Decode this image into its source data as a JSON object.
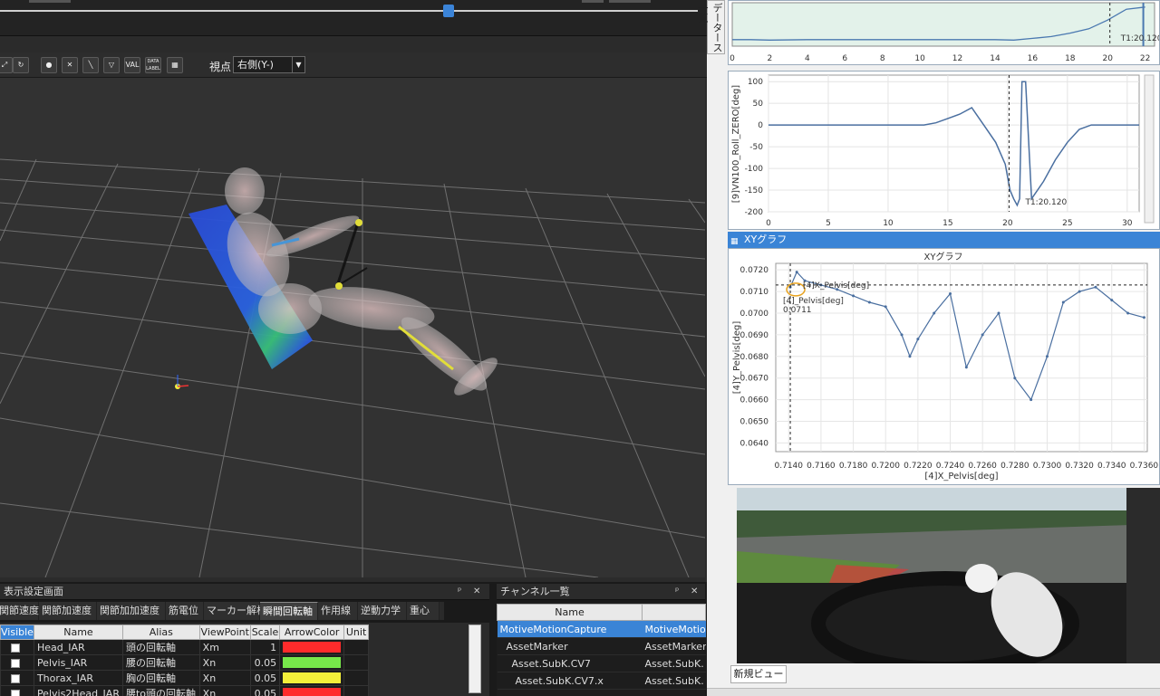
{
  "toolbar": {
    "viewpoint_label": "視点",
    "viewpoint_value": "右側(Y-)",
    "icons": [
      "fit-icon",
      "refresh-icon",
      "person-icon",
      "joint-icon",
      "bone-icon",
      "mesh-icon",
      "val-label-icon",
      "data-label-icon",
      "table-icon"
    ],
    "val_text": "VAL",
    "data_text": "DATA LABEL"
  },
  "settings_panel": {
    "title": "表示設定画面",
    "pin": "ᵖ",
    "close": "✕",
    "tabs": [
      "関節速度",
      "関節加速度",
      "関節加加速度",
      "筋電位",
      "マーカー解析",
      "瞬間回転軸",
      "作用線",
      "逆動力学",
      "重心"
    ],
    "active_tab": "瞬間回転軸",
    "columns": [
      "Visible",
      "Name",
      "Alias",
      "ViewPoint",
      "Scale",
      "ArrowColor",
      "Unit"
    ],
    "rows": [
      {
        "name": "Head_IAR",
        "alias": "頭の回転軸",
        "viewpoint": "Xm",
        "scale": "1",
        "color": "#ff2b2b"
      },
      {
        "name": "Pelvis_IAR",
        "alias": "腰の回転軸",
        "viewpoint": "Xn",
        "scale": "0.05",
        "color": "#77e84a"
      },
      {
        "name": "Thorax_IAR",
        "alias": "胸の回転軸",
        "viewpoint": "Xn",
        "scale": "0.05",
        "color": "#f4f03a"
      },
      {
        "name": "Pelvis2Head_IAR",
        "alias": "腰to頭の回転軸",
        "viewpoint": "Xn",
        "scale": "0.05",
        "color": "#ff2b2b"
      }
    ]
  },
  "channel_panel": {
    "title": "チャンネル一覧",
    "pin": "ᵖ",
    "close": "✕",
    "columns": [
      "Name",
      ""
    ],
    "rows": [
      {
        "name": "MotiveMotionCapture",
        "value": "MotiveMotionC",
        "selected": true
      },
      {
        "name": "AssetMarker",
        "value": "AssetMarker",
        "selected": false
      },
      {
        "name": "Asset.SubK.CV7",
        "value": "Asset.SubK.",
        "selected": false
      },
      {
        "name": "Asset.SubK.CV7.x",
        "value": "Asset.SubK.",
        "selected": false
      }
    ]
  },
  "side_tab": "データース一覧",
  "chart_top": {
    "x_ticks": [
      "0",
      "2",
      "4",
      "6",
      "8",
      "10",
      "12",
      "14",
      "16",
      "18",
      "20",
      "22"
    ],
    "marker_label": "T1:20.120"
  },
  "chart_roll": {
    "ylabel": "[9]VN100_Roll_ZERO[deg]",
    "y_ticks": [
      "100",
      "50",
      "0",
      "-50",
      "-100",
      "-150",
      "-200"
    ],
    "x_ticks": [
      "0",
      "5",
      "10",
      "15",
      "20",
      "25",
      "30"
    ],
    "marker_label": "T1:20.120"
  },
  "xy_panel": {
    "window_title": "XYグラフ",
    "chart_title": "XYグラフ",
    "ylabel": "[4]Y_Pelvis[deg]",
    "xlabel": "[4]X_Pelvis[deg]",
    "y_ticks": [
      "0.0720",
      "0.0710",
      "0.0700",
      "0.0690",
      "0.0680",
      "0.0670",
      "0.0660",
      "0.0650",
      "0.0640"
    ],
    "x_ticks": [
      "0.7140",
      "0.7160",
      "0.7180",
      "0.7200",
      "0.7220",
      "0.7240",
      "0.7260",
      "0.7280",
      "0.7300",
      "0.7320",
      "0.7340",
      "0.7360"
    ],
    "annot_1": "[4]X_Pelvis[deg]",
    "annot_2": "[4]_Pelvis[deg]",
    "annot_3": "0.0711"
  },
  "video_panel": {
    "tab_label": "新規ビュー"
  },
  "chart_data": [
    {
      "type": "line",
      "title": "",
      "xlabel": "",
      "ylabel": "",
      "xlim": [
        0,
        22.5
      ],
      "series": [
        {
          "x": [
            0,
            1,
            2,
            4,
            6,
            8,
            10,
            12,
            14,
            15,
            16,
            17,
            18,
            19,
            20,
            21,
            22
          ],
          "y": [
            0.15,
            0.15,
            0.14,
            0.15,
            0.15,
            0.15,
            0.15,
            0.15,
            0.15,
            0.14,
            0.18,
            0.22,
            0.3,
            0.4,
            0.6,
            0.85,
            0.9
          ]
        }
      ],
      "marker_x": 20.12
    },
    {
      "type": "line",
      "title": "",
      "ylabel": "[9]VN100_Roll_ZERO[deg]",
      "xlim": [
        0,
        31
      ],
      "ylim": [
        -200,
        115
      ],
      "series": [
        {
          "x": [
            0,
            5,
            10,
            13,
            14,
            15,
            16,
            17,
            18,
            19,
            19.8,
            20.2,
            20.5,
            20.8,
            21,
            21.2,
            21.5,
            22,
            23,
            24,
            25,
            26,
            27,
            28,
            31
          ],
          "y": [
            0,
            0,
            0,
            0,
            5,
            15,
            25,
            40,
            0,
            -40,
            -90,
            -150,
            -170,
            -185,
            -170,
            100,
            100,
            -170,
            -130,
            -80,
            -40,
            -10,
            0,
            0,
            0
          ]
        }
      ],
      "marker_x": 20.12
    },
    {
      "type": "scatter",
      "title": "XYグラフ",
      "xlabel": "[4]X_Pelvis[deg]",
      "ylabel": "[4]Y_Pelvis[deg]",
      "xlim": [
        0.7132,
        0.7362
      ],
      "ylim": [
        0.0636,
        0.0723
      ],
      "series": [
        {
          "x": [
            0.7141,
            0.7145,
            0.715,
            0.716,
            0.717,
            0.718,
            0.719,
            0.72,
            0.721,
            0.7215,
            0.722,
            0.723,
            0.724,
            0.725,
            0.726,
            0.727,
            0.728,
            0.729,
            0.73,
            0.731,
            0.732,
            0.733,
            0.734,
            0.735,
            0.736
          ],
          "y": [
            0.0712,
            0.0719,
            0.0715,
            0.0713,
            0.0711,
            0.0708,
            0.0705,
            0.0703,
            0.069,
            0.068,
            0.0688,
            0.07,
            0.0709,
            0.0675,
            0.069,
            0.07,
            0.067,
            0.066,
            0.068,
            0.0705,
            0.071,
            0.0712,
            0.0706,
            0.07,
            0.0698
          ]
        }
      ],
      "marker_x": 0.7141,
      "marker_y": 0.0713
    }
  ]
}
